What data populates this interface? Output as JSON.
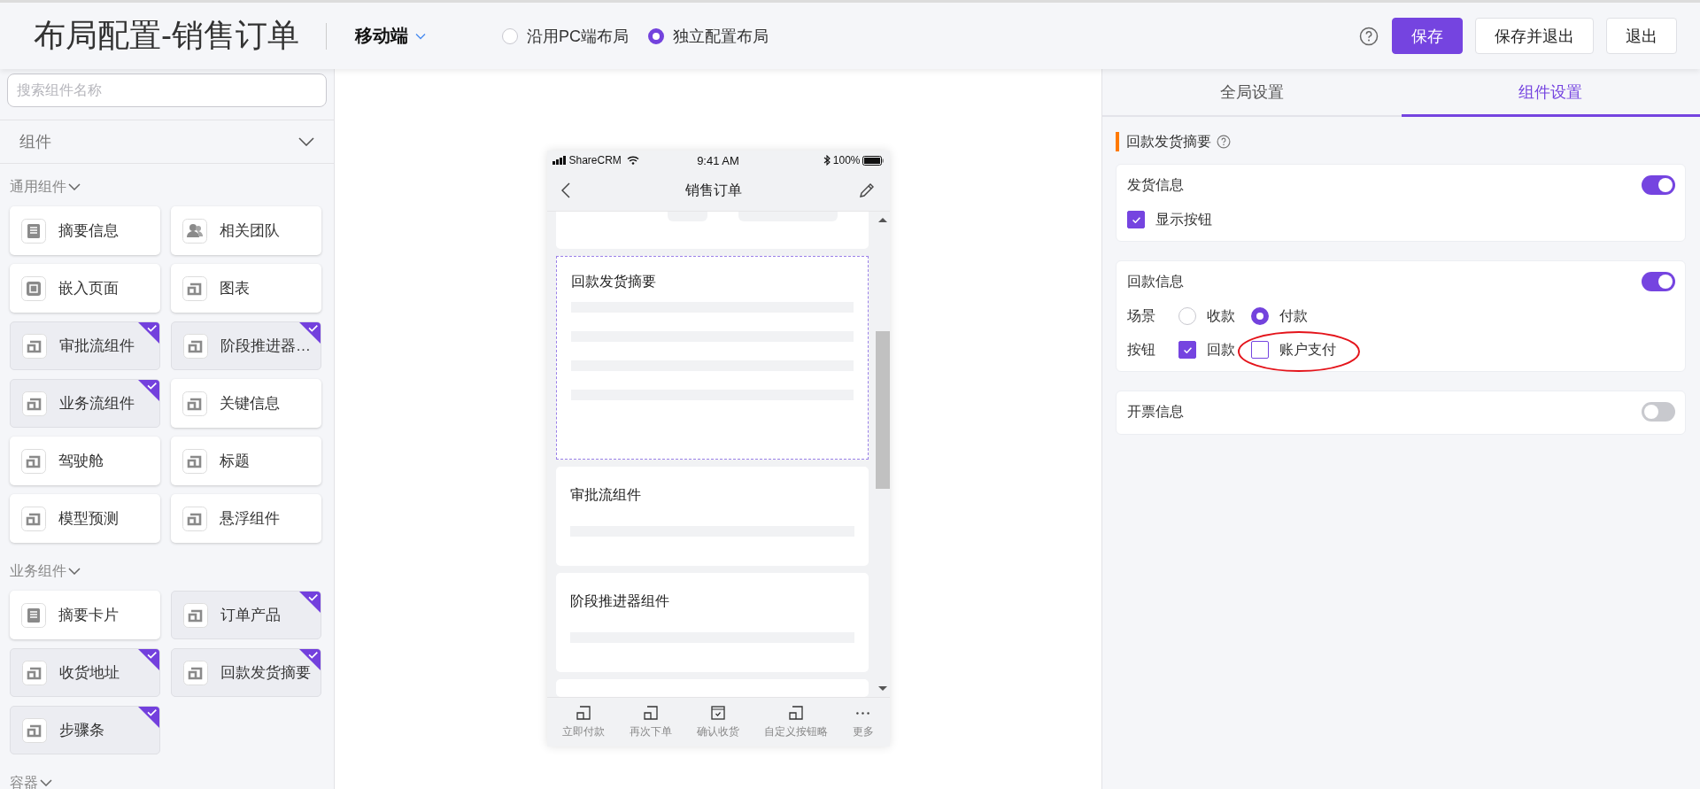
{
  "header": {
    "title": "布局配置-销售订单",
    "device": "移动端",
    "layout_modes": [
      {
        "label": "沿用PC端布局",
        "selected": false
      },
      {
        "label": "独立配置布局",
        "selected": true
      }
    ],
    "buttons": [
      {
        "label": "保存",
        "kind": "primary"
      },
      {
        "label": "保存并退出",
        "kind": "default"
      },
      {
        "label": "退出",
        "kind": "default"
      }
    ]
  },
  "sidebar": {
    "search": {
      "placeholder": "搜索组件名称"
    },
    "panel_title": "组件",
    "groups": [
      {
        "title": "通用组件",
        "items": [
          {
            "label": "摘要信息",
            "kind": "list",
            "added": false
          },
          {
            "label": "相关团队",
            "kind": "team",
            "added": false
          },
          {
            "label": "嵌入页面",
            "kind": "embed",
            "added": false
          },
          {
            "label": "图表",
            "kind": "generic",
            "added": false
          },
          {
            "label": "审批流组件",
            "kind": "generic",
            "added": true
          },
          {
            "label": "阶段推进器…",
            "kind": "generic",
            "added": true
          },
          {
            "label": "业务流组件",
            "kind": "generic",
            "added": true
          },
          {
            "label": "关键信息",
            "kind": "generic",
            "added": false
          },
          {
            "label": "驾驶舱",
            "kind": "generic",
            "added": false
          },
          {
            "label": "标题",
            "kind": "generic",
            "added": false
          },
          {
            "label": "模型预测",
            "kind": "generic",
            "added": false
          },
          {
            "label": "悬浮组件",
            "kind": "generic",
            "added": false
          }
        ]
      },
      {
        "title": "业务组件",
        "items": [
          {
            "label": "摘要卡片",
            "kind": "list",
            "added": false
          },
          {
            "label": "订单产品",
            "kind": "generic",
            "added": true
          },
          {
            "label": "收货地址",
            "kind": "generic",
            "added": true
          },
          {
            "label": "回款发货摘要",
            "kind": "generic",
            "added": true
          },
          {
            "label": "步骤条",
            "kind": "generic",
            "added": true
          }
        ]
      },
      {
        "title": "容器"
      }
    ]
  },
  "phone": {
    "carrier": "ShareCRM",
    "time": "9:41 AM",
    "battery": "100%",
    "title": "销售订单",
    "cards": [
      {
        "kind": "partial",
        "selected": false
      },
      {
        "kind": "tall",
        "title": "回款发货摘要",
        "selected": true
      },
      {
        "kind": "short",
        "title": "审批流组件",
        "selected": false
      },
      {
        "kind": "short",
        "title": "阶段推进器组件",
        "selected": false
      },
      {
        "kind": "partial_bottom",
        "selected": false
      }
    ],
    "actions": [
      {
        "label": "立即付款",
        "kind": "box"
      },
      {
        "label": "再次下单",
        "kind": "box"
      },
      {
        "label": "确认收货",
        "kind": "calendar"
      },
      {
        "label": "自定义按钮略",
        "kind": "box"
      },
      {
        "label": "更多",
        "kind": "more"
      }
    ]
  },
  "settings": {
    "tabs": [
      {
        "label": "全局设置",
        "selected": false
      },
      {
        "label": "组件设置",
        "selected": true
      }
    ],
    "section_title": "回款发货摘要",
    "cards": [
      {
        "title": "发货信息",
        "on": true,
        "rows": [
          {
            "kind": "checks",
            "options": [
              {
                "label": "显示按钮",
                "checked": true
              }
            ]
          }
        ]
      },
      {
        "title": "回款信息",
        "on": true,
        "rows": [
          {
            "kind": "radios",
            "label": "场景",
            "options": [
              {
                "label": "收款",
                "selected": false
              },
              {
                "label": "付款",
                "selected": true
              }
            ]
          },
          {
            "kind": "checks",
            "label": "按钮",
            "options": [
              {
                "label": "回款",
                "checked": true
              },
              {
                "label": "账户支付",
                "checked": false,
                "circled": true
              }
            ]
          }
        ]
      },
      {
        "title": "开票信息",
        "on": false
      }
    ]
  }
}
